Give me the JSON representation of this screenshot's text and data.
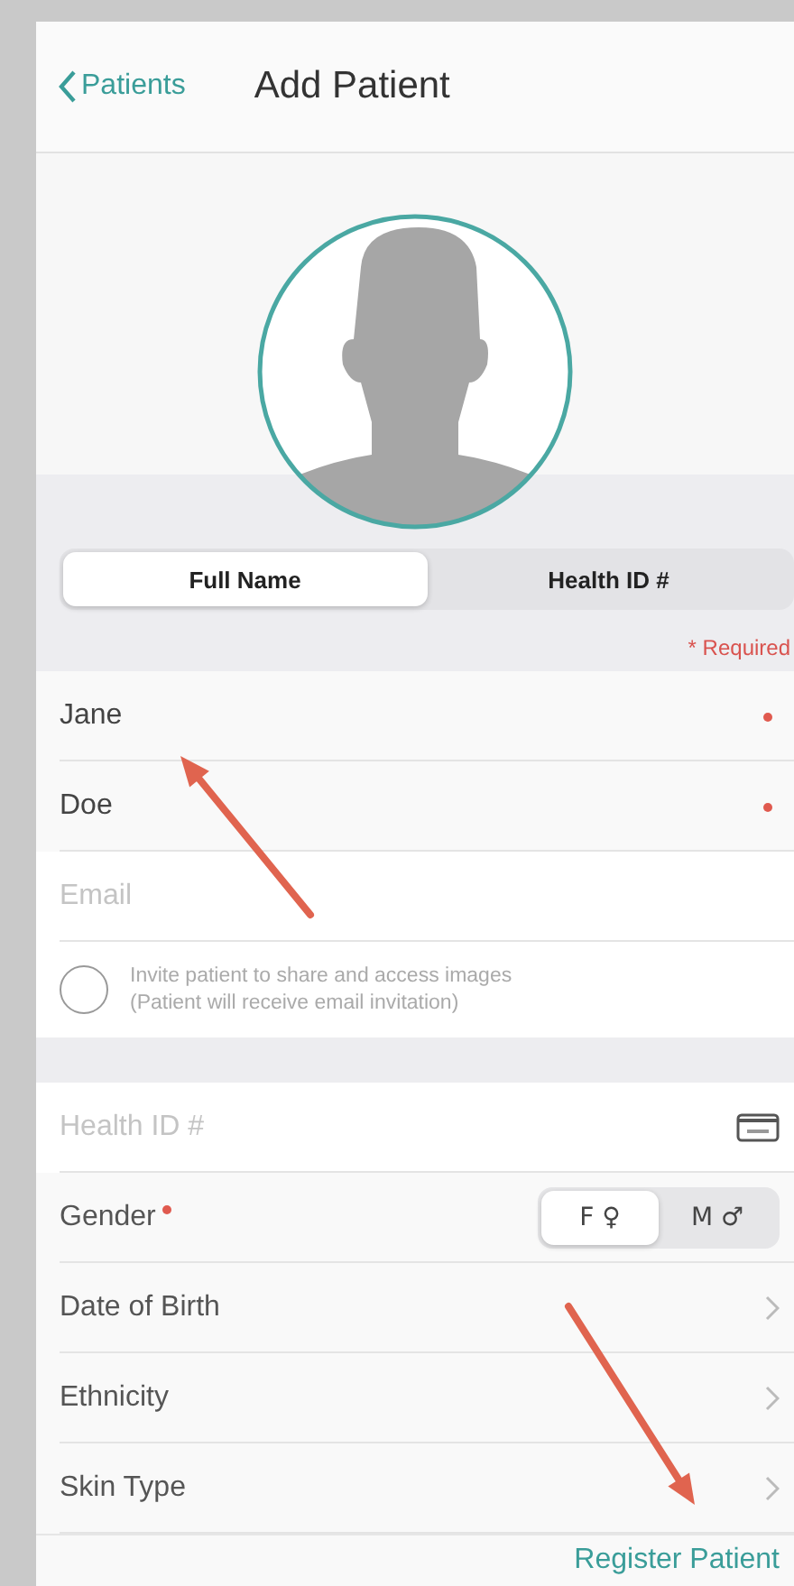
{
  "nav": {
    "back_label": "Patients",
    "title": "Add Patient"
  },
  "id_mode_tabs": [
    {
      "label": "Full Name",
      "selected": true
    },
    {
      "label": "Health ID #",
      "selected": false
    }
  ],
  "required_note": "* Required",
  "name_fields": [
    {
      "value": "Jane",
      "required": true
    },
    {
      "value": "Doe",
      "required": true
    },
    {
      "placeholder": "Email",
      "required": false
    }
  ],
  "invite": {
    "checked": false,
    "text": "Invite patient to share and access images",
    "subtext": "(Patient will receive email invitation)"
  },
  "health_id_field": {
    "placeholder": "Health ID #"
  },
  "gender": {
    "label": "Gender",
    "required": true,
    "options": [
      {
        "label": "F ♀",
        "selected": true
      },
      {
        "label": "M ♂",
        "selected": false
      }
    ]
  },
  "detail_rows": [
    {
      "label": "Date of Birth"
    },
    {
      "label": "Ethnicity"
    },
    {
      "label": "Skin Type"
    }
  ],
  "register_button": "Register Patient"
}
